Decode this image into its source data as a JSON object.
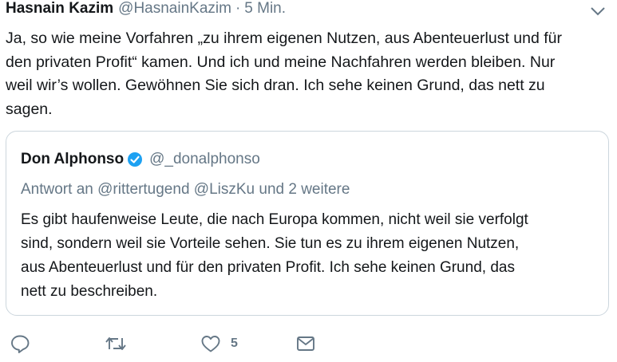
{
  "tweet": {
    "author_name": "Hasnain Kazim",
    "author_handle": "@HasnainKazim",
    "separator": "·",
    "time": "5 Min.",
    "text_lines": [
      "Ja, so wie meine Vorfahren „zu ihrem eigenen Nutzen, aus Abenteuerlust und für",
      "den privaten Profit“ kamen. Und ich und meine Nachfahren werden bleiben. Nur",
      "weil wir’s wollen. Gewöhnen Sie sich dran. Ich sehe keinen Grund, das nett zu",
      "sagen."
    ],
    "menu_icon": "chevron-down-icon"
  },
  "quoted": {
    "author_name": "Don Alphonso",
    "verified_icon": "verified-badge-icon",
    "author_handle": "@_donalphonso",
    "reply_to": "Antwort an @rittertugend @LiszKu und 2 weitere",
    "text_lines": [
      "Es gibt haufenweise Leute, die nach Europa kommen, nicht weil sie verfolgt",
      "sind, sondern weil sie Vorteile sehen. Sie tun es zu ihrem eigenen Nutzen,",
      "aus Abenteuerlust und für den privaten Profit. Ich sehe keinen Grund, das",
      "nett zu beschreiben."
    ]
  },
  "actions": {
    "reply_icon": "reply-icon",
    "retweet_icon": "retweet-icon",
    "like_icon": "heart-icon",
    "like_count": "5",
    "message_icon": "envelope-icon"
  },
  "colors": {
    "text": "#14171a",
    "secondary": "#657786",
    "border": "#ccd6dd",
    "verified": "#1da1f2"
  }
}
